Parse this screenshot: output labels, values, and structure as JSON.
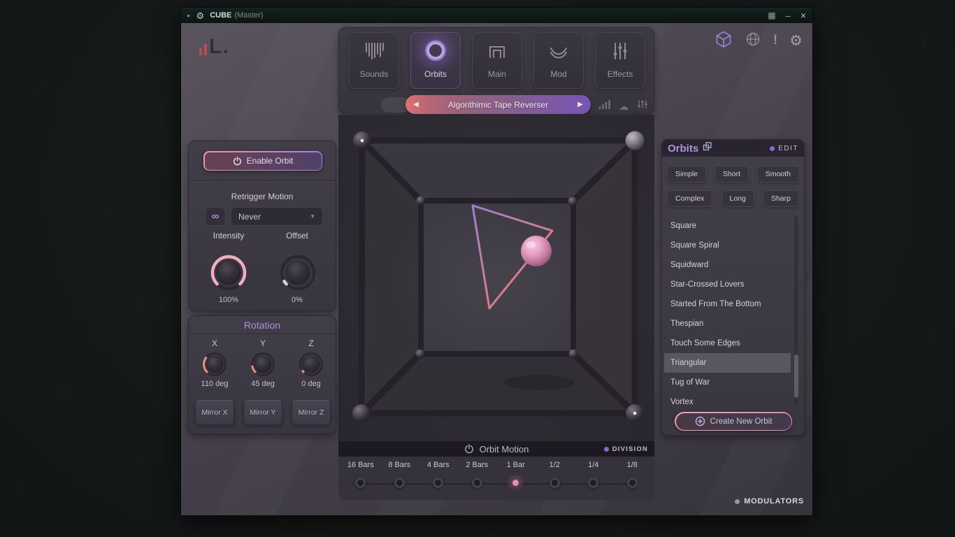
{
  "icons": {
    "expand_arrow": "▸",
    "grid": "▦",
    "minimize": "–",
    "close": "×",
    "gear": "⚙",
    "cloud": "☁",
    "infinity": "∞",
    "dropdown_arrow": "▼",
    "prev_arrow": "◀",
    "next_arrow": "▶",
    "alert": "!"
  },
  "colors": {
    "accent_pink": "#e8899b",
    "accent_purple": "#9b7fd0",
    "knob_ring": "#f3adc0",
    "rotation_arc": "#ec8f7e",
    "selected_division_dot": "#ef86b5"
  },
  "titlebar": {
    "title": "CUBE",
    "subtitle": "(Master)"
  },
  "logo": {
    "text": "L."
  },
  "nav": {
    "tabs": [
      {
        "label": "Sounds"
      },
      {
        "label": "Orbits",
        "selected": true
      },
      {
        "label": "Main"
      },
      {
        "label": "Mod"
      },
      {
        "label": "Effects"
      }
    ]
  },
  "preset": {
    "name": "Algorithimic Tape Reverser"
  },
  "controls": {
    "enable_orbit": "Enable Orbit",
    "retrigger_label": "Retrigger Motion",
    "retrigger_value": "Never",
    "intensity_label": "Intensity",
    "intensity_value": "100%",
    "offset_label": "Offset",
    "offset_value": "0%"
  },
  "rotation": {
    "title": "Rotation",
    "axes": [
      {
        "axis": "X",
        "value": "110 deg",
        "mirror": "Mirror X"
      },
      {
        "axis": "Y",
        "value": "45 deg",
        "mirror": "Mirror Y"
      },
      {
        "axis": "Z",
        "value": "0 deg",
        "mirror": "Mirror Z"
      }
    ]
  },
  "orbits_panel": {
    "title": "Orbits",
    "edit_label": "EDIT",
    "filters": [
      "Simple",
      "Short",
      "Smooth",
      "Complex",
      "Long",
      "Sharp"
    ],
    "list": [
      "Square",
      "Square Spiral",
      "Squidward",
      "Star-Crossed Lovers",
      "Started From The Bottom",
      "Thespian",
      "Touch Some Edges",
      "Triangular",
      "Tug of War",
      "Vortex"
    ],
    "selected_item": "Triangular",
    "create_label": "Create New Orbit"
  },
  "orbit_motion": {
    "title": "Orbit Motion",
    "division_label": "DIVISION",
    "divisions": [
      "16 Bars",
      "8 Bars",
      "4 Bars",
      "2 Bars",
      "1 Bar",
      "1/2",
      "1/4",
      "1/8"
    ],
    "selected_division": "1 Bar"
  },
  "modulators_label": "MODULATORS"
}
